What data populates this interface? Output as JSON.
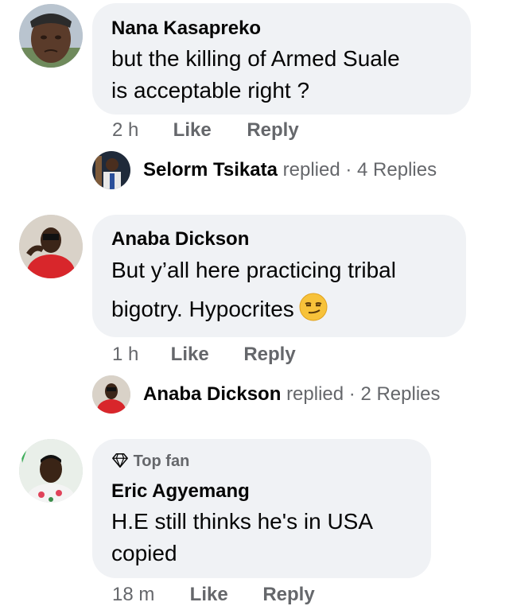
{
  "comments": [
    {
      "author": "Nana Kasapreko",
      "lines": [
        "but the killing of Armed Suale",
        "is acceptable right ?"
      ],
      "time": "2 h",
      "like_label": "Like",
      "reply_label": "Reply",
      "replies": {
        "author": "Selorm Tsikata",
        "verb": "replied",
        "separator": "·",
        "count": "4 Replies"
      }
    },
    {
      "author": "Anaba Dickson",
      "lines": [
        "But y’all here practicing tribal",
        "bigotry. Hypocrites"
      ],
      "emoji": "smirking-face",
      "time": "1 h",
      "like_label": "Like",
      "reply_label": "Reply",
      "replies": {
        "author": "Anaba Dickson",
        "verb": "replied",
        "separator": "·",
        "count": "2 Replies"
      }
    },
    {
      "badge": "Top fan",
      "author": "Eric Agyemang",
      "lines": [
        "H.E still thinks he's in USA",
        "copied"
      ],
      "time": "18 m",
      "like_label": "Like",
      "reply_label": "Reply"
    }
  ],
  "colors": {
    "bubble": "#f0f2f5",
    "text": "#050505",
    "secondary": "#65676b",
    "emoji": "#f7c23a"
  }
}
